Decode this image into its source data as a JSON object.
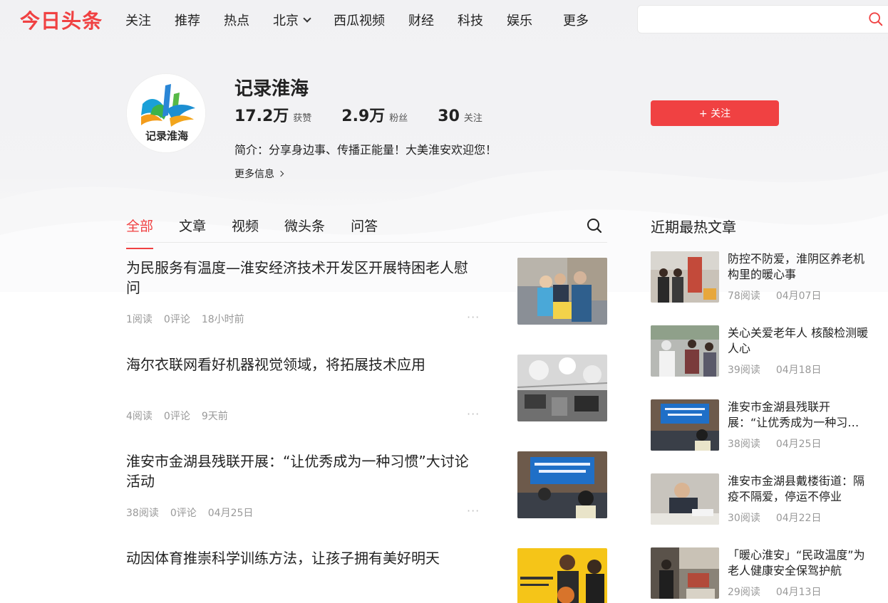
{
  "brand": {
    "logo_text": "今日头条",
    "accent_color": "#f04142"
  },
  "nav": {
    "items": [
      "关注",
      "推荐",
      "热点",
      "北京",
      "西瓜视频",
      "财经",
      "科技",
      "娱乐"
    ],
    "more": "更多"
  },
  "search": {
    "placeholder": ""
  },
  "profile": {
    "name": "记录淮海",
    "avatar_text": "记录淮海",
    "stats": [
      {
        "num": "17.2万",
        "label": "获赞"
      },
      {
        "num": "2.9万",
        "label": "粉丝"
      },
      {
        "num": "30",
        "label": "关注"
      }
    ],
    "bio": "简介：分享身边事、传播正能量！大美淮安欢迎您！",
    "more_info": "更多信息",
    "follow_label": "+ 关注"
  },
  "tabs": [
    "全部",
    "文章",
    "视频",
    "微头条",
    "问答"
  ],
  "articles": [
    {
      "title": "为民服务有温度—淮安经济技术开发区开展特困老人慰问",
      "reads": "1阅读",
      "comments": "0评论",
      "time": "18小时前"
    },
    {
      "title": "海尔衣联网看好机器视觉领域，将拓展技术应用",
      "reads": "4阅读",
      "comments": "0评论",
      "time": "9天前"
    },
    {
      "title": "淮安市金湖县残联开展：“让优秀成为一种习惯”大讨论活动",
      "reads": "38阅读",
      "comments": "0评论",
      "time": "04月25日"
    },
    {
      "title": "动因体育推崇科学训练方法，让孩子拥有美好明天",
      "reads": "",
      "comments": "",
      "time": ""
    }
  ],
  "sidebar": {
    "title": "近期最热文章",
    "items": [
      {
        "title": "防控不防爱，淮阴区养老机构里的暖心事",
        "reads": "78阅读",
        "date": "04月07日"
      },
      {
        "title": "关心关爱老年人 核酸检测暖人心",
        "reads": "39阅读",
        "date": "04月18日"
      },
      {
        "title": "淮安市金湖县残联开展：“让优秀成为一种习惯”大讨论活动",
        "reads": "38阅读",
        "date": "04月25日"
      },
      {
        "title": "淮安市金湖县戴楼街道：隔疫不隔爱，停运不停业",
        "reads": "30阅读",
        "date": "04月22日"
      },
      {
        "title": "「暖心淮安」“民政温度”为老人健康安全保驾护航",
        "reads": "29阅读",
        "date": "04月13日"
      }
    ]
  }
}
